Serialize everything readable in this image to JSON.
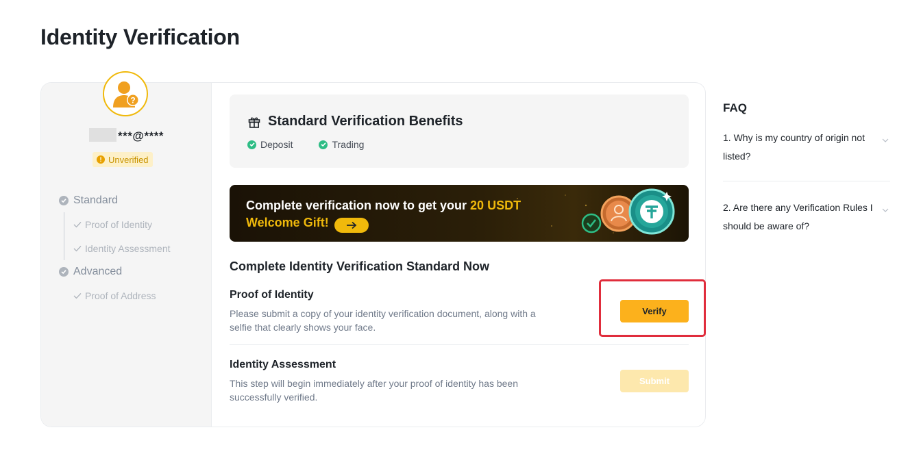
{
  "page": {
    "title": "Identity Verification"
  },
  "profile": {
    "user_id": "***@****",
    "status": "Unverified"
  },
  "levels": [
    {
      "label": "Standard",
      "steps": [
        "Proof of Identity",
        "Identity Assessment"
      ]
    },
    {
      "label": "Advanced",
      "steps": [
        "Proof of Address"
      ]
    }
  ],
  "benefits": {
    "title": "Standard Verification Benefits",
    "items": [
      "Deposit",
      "Trading"
    ]
  },
  "promo": {
    "line1": "Complete verification now to get your ",
    "amount": "20 USDT",
    "line2": "Welcome Gift!"
  },
  "main": {
    "section_title": "Complete Identity Verification Standard Now",
    "tasks": [
      {
        "title": "Proof of Identity",
        "description": "Please submit a copy of your identity verification document, along with a selfie that clearly shows your face.",
        "button": "Verify"
      },
      {
        "title": "Identity Assessment",
        "description": "This step will begin immediately after your proof of identity has been successfully verified.",
        "button": "Submit"
      }
    ]
  },
  "faq": {
    "title": "FAQ",
    "items": [
      "1. Why is my country of origin not listed?",
      "2. Are there any Verification Rules I should be aware of?"
    ]
  },
  "colors": {
    "accent": "#fcb11c",
    "highlight": "#e02d3c",
    "success": "#2ebd85",
    "warning": "#c99400"
  }
}
